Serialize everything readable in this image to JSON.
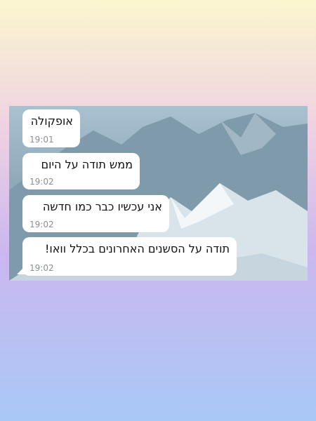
{
  "messages": [
    {
      "text": "אופקולה",
      "time": "19:01"
    },
    {
      "text": "ממש תודה על היום",
      "time": "19:02"
    },
    {
      "text": "אני עכשיו כבר כמו חדשה",
      "time": "19:02"
    },
    {
      "text": "תודה על הסשנים האחרונים בכלל וואו!",
      "time": "19:02"
    }
  ]
}
